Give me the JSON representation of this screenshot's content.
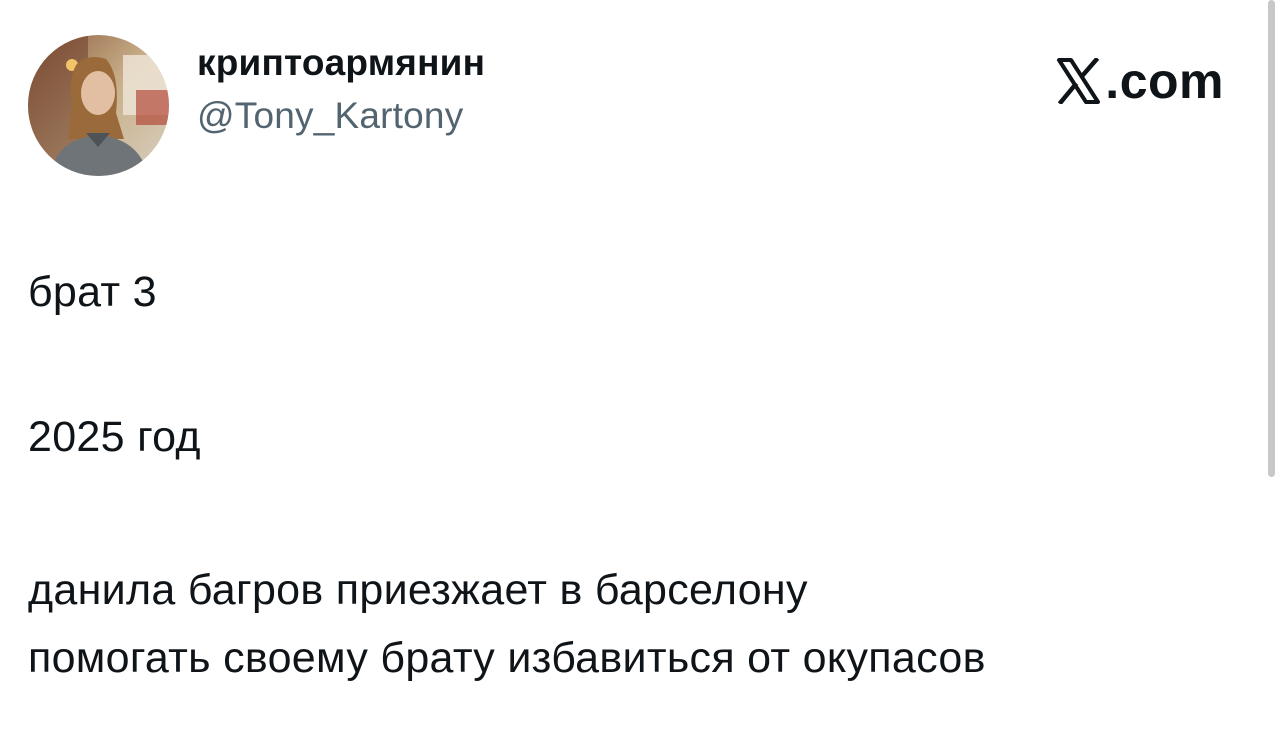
{
  "author": {
    "display_name": "криптоармянин",
    "handle": "@Tony_Kartony",
    "avatar_icon": "profile-photo"
  },
  "brand": {
    "logo_icon": "x-logo-icon",
    "label": ".com"
  },
  "tweet": {
    "lines": [
      "брат 3",
      "2025 год",
      "данила багров приезжает в барселону",
      "помогать своему брату избавиться от окупасов"
    ]
  },
  "colors": {
    "text_primary": "#0f1419",
    "text_secondary": "#536471",
    "background": "#ffffff"
  }
}
